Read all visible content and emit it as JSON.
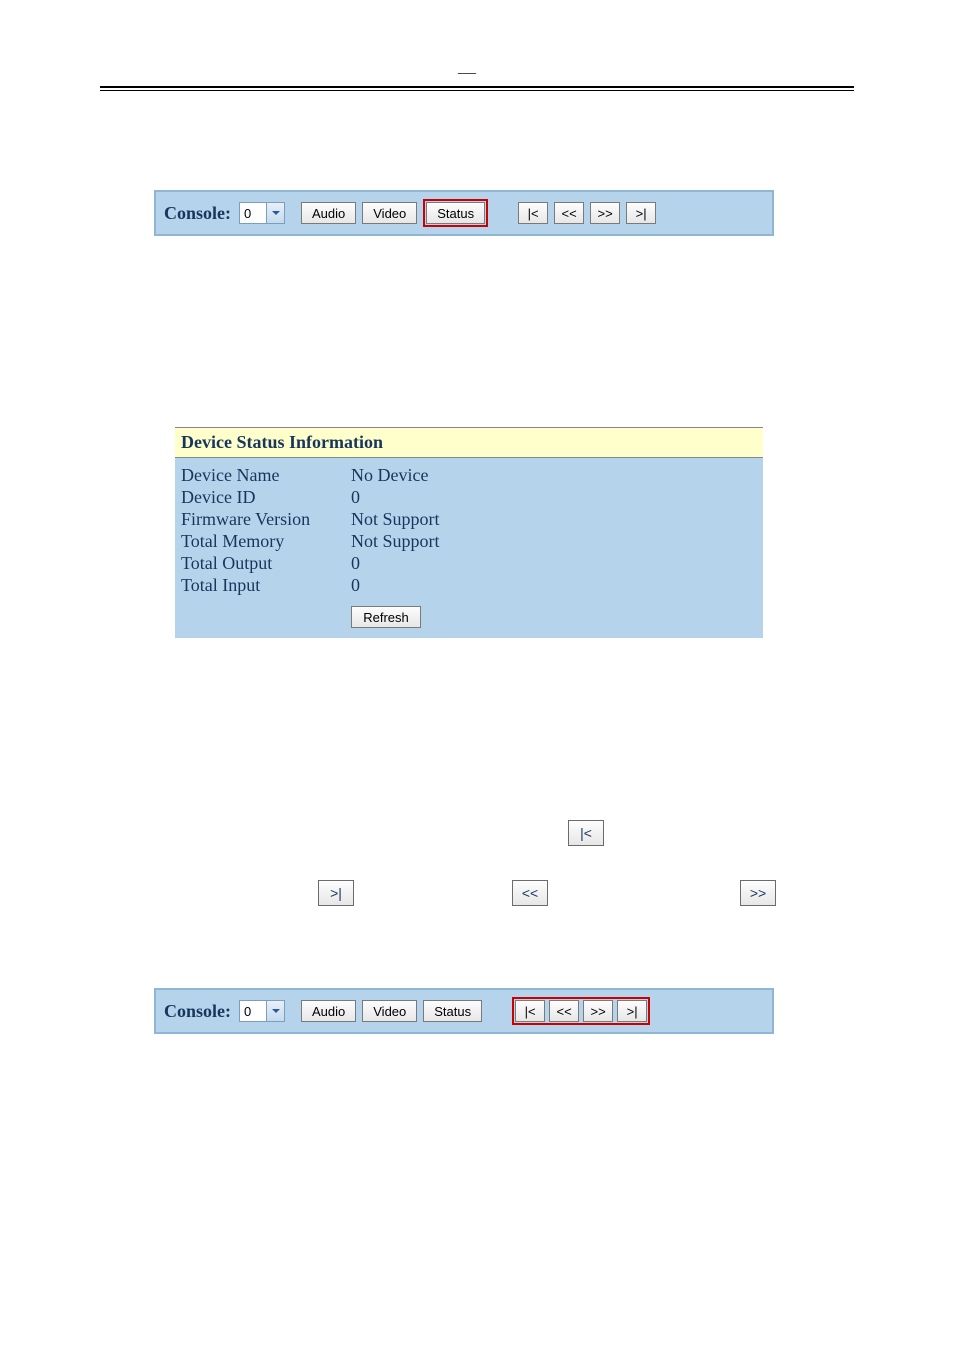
{
  "page_mark": "—",
  "console": {
    "label": "Console:",
    "selected": "0",
    "audio": "Audio",
    "video": "Video",
    "status": "Status",
    "nav_first": "|<",
    "nav_prev": "<<",
    "nav_next": ">>",
    "nav_last": ">|"
  },
  "status_panel": {
    "heading": "Device Status Information",
    "rows": [
      {
        "k": "Device Name",
        "v": "No Device"
      },
      {
        "k": "Device ID",
        "v": "0"
      },
      {
        "k": "Firmware Version",
        "v": "Not Support"
      },
      {
        "k": "Total Memory",
        "v": "Not Support"
      },
      {
        "k": "Total Output",
        "v": "0"
      },
      {
        "k": "Total Input",
        "v": "0"
      }
    ],
    "refresh": "Refresh"
  },
  "floating": {
    "first": "|<",
    "last": ">|",
    "prev": "<<",
    "next": ">>"
  }
}
